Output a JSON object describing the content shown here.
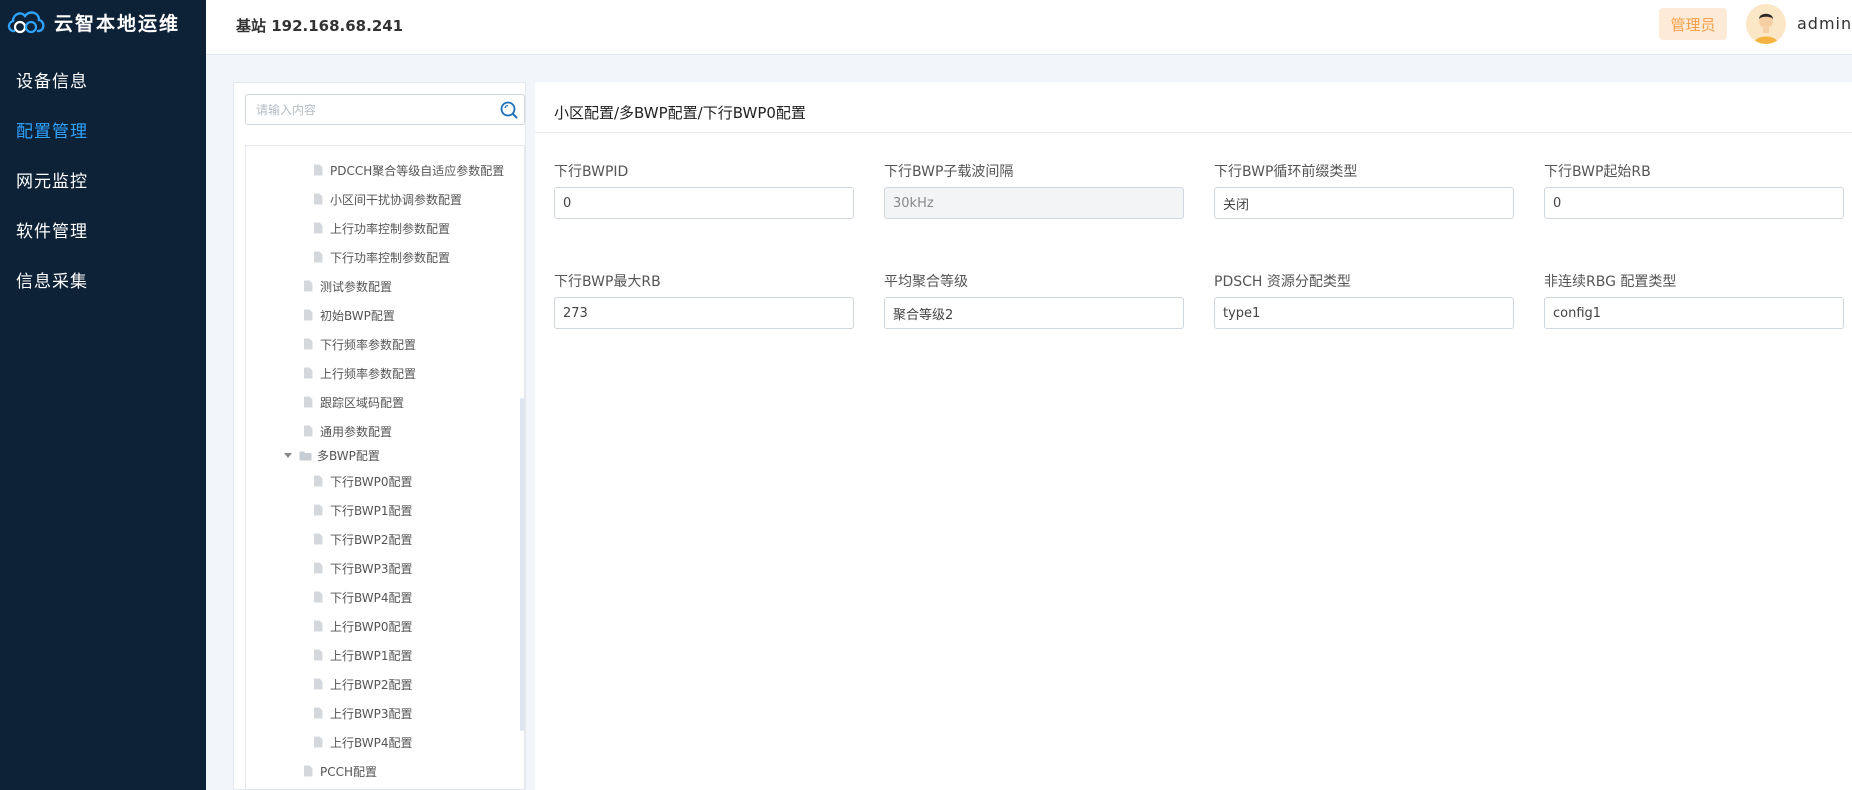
{
  "app": {
    "title": "云智本地运维"
  },
  "sidebar": {
    "items": [
      {
        "label": "设备信息",
        "active": false
      },
      {
        "label": "配置管理",
        "active": true
      },
      {
        "label": "网元监控",
        "active": false
      },
      {
        "label": "软件管理",
        "active": false
      },
      {
        "label": "信息采集",
        "active": false
      }
    ]
  },
  "header": {
    "station": "基站 192.168.68.241",
    "role": "管理员",
    "username": "admin"
  },
  "tree": {
    "search_placeholder": "请输入内容",
    "items": [
      "PDCCH聚合等级自适应参数配置",
      "小区间干扰协调参数配置",
      "上行功率控制参数配置",
      "下行功率控制参数配置",
      "测试参数配置",
      "初始BWP配置",
      "下行频率参数配置",
      "上行频率参数配置",
      "跟踪区域码配置",
      "通用参数配置",
      "多BWP配置",
      "下行BWP0配置",
      "下行BWP1配置",
      "下行BWP2配置",
      "下行BWP3配置",
      "下行BWP4配置",
      "上行BWP0配置",
      "上行BWP1配置",
      "上行BWP2配置",
      "上行BWP3配置",
      "上行BWP4配置",
      "PCCH配置"
    ]
  },
  "content": {
    "breadcrumb": "小区配置/多BWP配置/下行BWP0配置",
    "fields": [
      {
        "label": "下行BWPID",
        "value": "0"
      },
      {
        "label": "下行BWP子载波间隔",
        "value": "30kHz"
      },
      {
        "label": "下行BWP循环前缀类型",
        "value": "关闭"
      },
      {
        "label": "下行BWP起始RB",
        "value": "0"
      },
      {
        "label": "下行BWP最大RB",
        "value": "273"
      },
      {
        "label": "平均聚合等级",
        "value": "聚合等级2"
      },
      {
        "label": "PDSCH 资源分配类型",
        "value": "type1"
      },
      {
        "label": "非连续RBG 配置类型",
        "value": "config1"
      }
    ]
  },
  "colors": {
    "sidebar_bg": "#0d2137",
    "nav_active": "#2fa3ff",
    "badge_bg": "#fdebd7",
    "badge_text": "#f5a04a"
  }
}
